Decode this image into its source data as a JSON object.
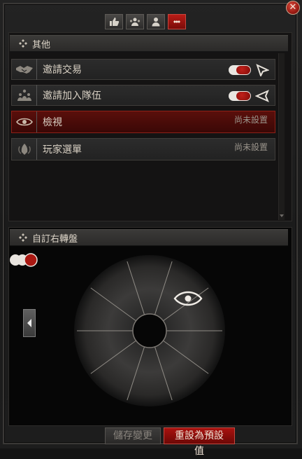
{
  "window": {
    "close_label": "✕"
  },
  "tabs": [
    {
      "name": "thumbs-up-icon"
    },
    {
      "name": "group-icon"
    },
    {
      "name": "player-icon"
    },
    {
      "name": "more-dots-icon",
      "active": true
    }
  ],
  "upper_section": {
    "title": "其他",
    "items": [
      {
        "label": "邀請交易",
        "icon": "handshake-icon",
        "toggle": true,
        "cursor_icon": "cursor-icon"
      },
      {
        "label": "邀請加入隊伍",
        "icon": "party-icon",
        "toggle": true,
        "cursor_icon": "arrow-left-icon"
      },
      {
        "label": "檢視",
        "icon": "eye-icon",
        "status": "尚未設置",
        "selected": true
      },
      {
        "label": "玩家選單",
        "icon": "wing-menu-icon",
        "status": "尚未設置"
      }
    ]
  },
  "lower_section": {
    "title": "自訂右轉盤",
    "wheel": {
      "segments": 10,
      "assigned_icon": "eye-icon"
    }
  },
  "footer": {
    "save_label": "儲存變更",
    "reset_label": "重設為預設值"
  },
  "colors": {
    "accent_red": "#9b1b14",
    "selected_row": "#4a0c08"
  }
}
